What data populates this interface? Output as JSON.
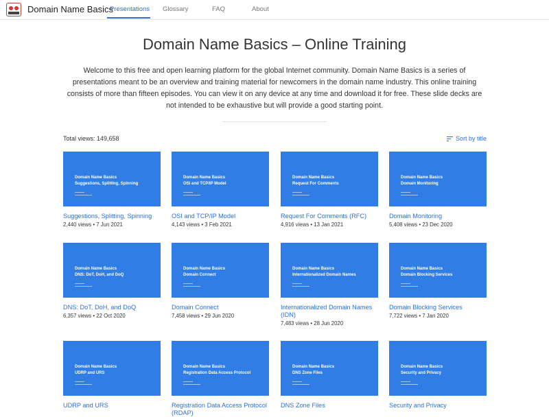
{
  "navbar": {
    "brand": "Domain Name Basics",
    "links": [
      "Presentations",
      "Glossary",
      "FAQ",
      "About"
    ]
  },
  "header": {
    "title": "Domain Name Basics – Online Training",
    "intro": "Welcome to this free and open learning platform for the global Internet community. Domain Name Basics is a series of presentations meant to be an overview and training material for newcomers in the domain name industry. This online training consists of more than fifteen episodes. You can view it on any device at any time and download it for free. These slide decks are not intended to be exhaustive but will provide a good starting point."
  },
  "toolbar": {
    "total_views": "Total views: 149,658",
    "sort_label": "Sort by title"
  },
  "cards": [
    {
      "thumb_title": "Domain Name Basics",
      "thumb_sub": "Suggestions, Splitting, Spinning",
      "title": "Suggestions, Splitting, Spinning",
      "meta": "2,440 views • 7 Jun 2021"
    },
    {
      "thumb_title": "Domain Name Basics",
      "thumb_sub": "OSI and TCP/IP Model",
      "title": "OSI and TCP/IP Model",
      "meta": "4,143 views • 3 Feb 2021"
    },
    {
      "thumb_title": "Domain Name Basics",
      "thumb_sub": "Request For Comments",
      "title": "Request For Comments (RFC)",
      "meta": "4,916 views • 13 Jan 2021"
    },
    {
      "thumb_title": "Domain Name Basics",
      "thumb_sub": "Domain Monitoring",
      "title": "Domain Monitoring",
      "meta": "5,408 views • 23 Dec 2020"
    },
    {
      "thumb_title": "Domain Name Basics",
      "thumb_sub": "DNS: DoT, DoH, and DoQ",
      "title": "DNS: DoT, DoH, and DoQ",
      "meta": "6,357 views • 22 Oct 2020"
    },
    {
      "thumb_title": "Domain Name Basics",
      "thumb_sub": "Domain Connect",
      "title": "Domain Connect",
      "meta": "7,458 views • 29 Jun 2020"
    },
    {
      "thumb_title": "Domain Name Basics",
      "thumb_sub": "Internationalized Domain Names",
      "title": "Internationalized Domain Names (IDN)",
      "meta": "7,483 views • 28 Jun 2020"
    },
    {
      "thumb_title": "Domain Name Basics",
      "thumb_sub": "Domain Blocking Services",
      "title": "Domain Blocking Services",
      "meta": "7,722 views • 7 Jan 2020"
    },
    {
      "thumb_title": "Domain Name Basics",
      "thumb_sub": "UDRP and URS",
      "title": "UDRP and URS",
      "meta": ""
    },
    {
      "thumb_title": "Domain Name Basics",
      "thumb_sub": "Registration Data Access Protocol",
      "title": "Registration Data Access Protocol (RDAP)",
      "meta": ""
    },
    {
      "thumb_title": "Domain Name Basics",
      "thumb_sub": "DNS Zone Files",
      "title": "DNS Zone Files",
      "meta": ""
    },
    {
      "thumb_title": "Domain Name Basics",
      "thumb_sub": "Security and Privacy",
      "title": "Security and Privacy",
      "meta": ""
    }
  ]
}
